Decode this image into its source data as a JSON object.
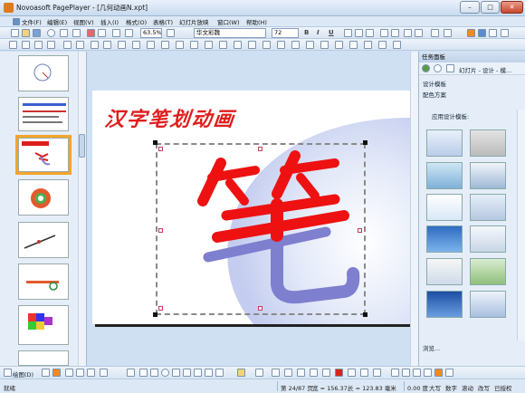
{
  "window": {
    "title": "Novoasoft PagePlayer - [几何动画N.xpt]",
    "controls": [
      "minimize",
      "maximize",
      "close"
    ]
  },
  "menubar": {
    "items": [
      "文件(F)",
      "编辑(E)",
      "视图(V)",
      "插入(I)",
      "格式(O)",
      "表格(T)",
      "幻灯片放映",
      "窗口(W)",
      "帮助(H)"
    ]
  },
  "toolbar": {
    "zoom": "63.5%",
    "font": "华文彩魏",
    "font_size": "72"
  },
  "slide": {
    "title": "汉字笔划动画",
    "big_character": "笔"
  },
  "task_pane": {
    "header": "任务面板",
    "dropdown": "幻灯片 - 设计 - 模...",
    "links": [
      "设计模板",
      "配色方案"
    ],
    "section_label": "应用设计模板:",
    "browse": "浏览..."
  },
  "drawbar": {
    "label": "绘图(D)"
  },
  "status": {
    "left": "就绪",
    "page": "第 24/87 页",
    "width": "宽 = 156.37,",
    "height": "长 = 123.83 毫米",
    "angle": "0.00 度",
    "indicators": [
      "大写",
      "数字",
      "滚动",
      "改写",
      "已授权"
    ]
  },
  "colors": {
    "title_red": "#e01d1d",
    "stroke_red": "#ee1111",
    "stroke_violet": "#7e7fcf",
    "selected_thumb": "#f4a52a"
  }
}
